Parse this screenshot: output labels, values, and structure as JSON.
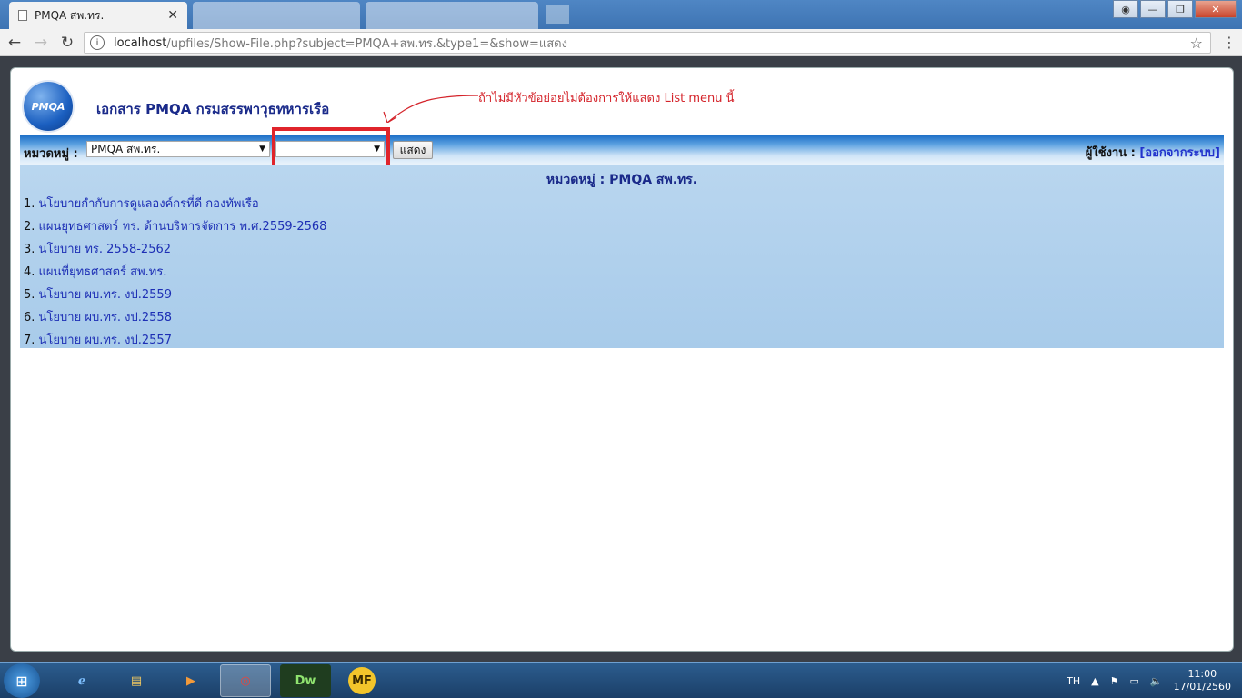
{
  "browser": {
    "active_tab_title": "PMQA สพ.ทร.",
    "url_host": "localhost",
    "url_path": "/upfiles/Show-File.php?subject=PMQA+สพ.ทร.&type1=&show=แสดง"
  },
  "page": {
    "logo_text": "PMQA",
    "site_title": "เอกสาร PMQA กรมสรรพาวุธทหารเรือ",
    "annotation": "ถ้าไม่มีหัวข้อย่อยไม่ต้องการให้แสดง   List menu นี้",
    "category_label": "หมวดหมู่ :",
    "category_selected": "PMQA สพ.ทร.",
    "subcategory_selected": "",
    "show_button": "แสดง",
    "user_label": "ผู้ใช้งาน :",
    "logout_link": "[ออกจากระบบ]",
    "content_title": "หมวดหมู่ : PMQA สพ.ทร.",
    "documents": [
      {
        "num": "1.",
        "title": "นโยบายกำกับการดูแลองค์กรที่ดี กองทัพเรือ"
      },
      {
        "num": "2.",
        "title": "แผนยุทธศาสตร์ ทร. ด้านบริหารจัดการ พ.ศ.2559-2568"
      },
      {
        "num": "3.",
        "title": "นโยบาย ทร. 2558-2562"
      },
      {
        "num": "4.",
        "title": "แผนที่ยุทธศาสตร์ สพ.ทร."
      },
      {
        "num": "5.",
        "title": "นโยบาย ผบ.ทร. งป.2559"
      },
      {
        "num": "6.",
        "title": "นโยบาย ผบ.ทร. งป.2558"
      },
      {
        "num": "7.",
        "title": "นโยบาย ผบ.ทร. งป.2557"
      }
    ]
  },
  "taskbar": {
    "language": "TH",
    "time": "11:00",
    "date": "17/01/2560",
    "apps": [
      "ie",
      "explorer",
      "media-player",
      "chrome",
      "Dw",
      "MF"
    ]
  },
  "colors": {
    "highlight": "#e0242b",
    "link": "#1d2fb5",
    "title": "#1a2a8a"
  }
}
